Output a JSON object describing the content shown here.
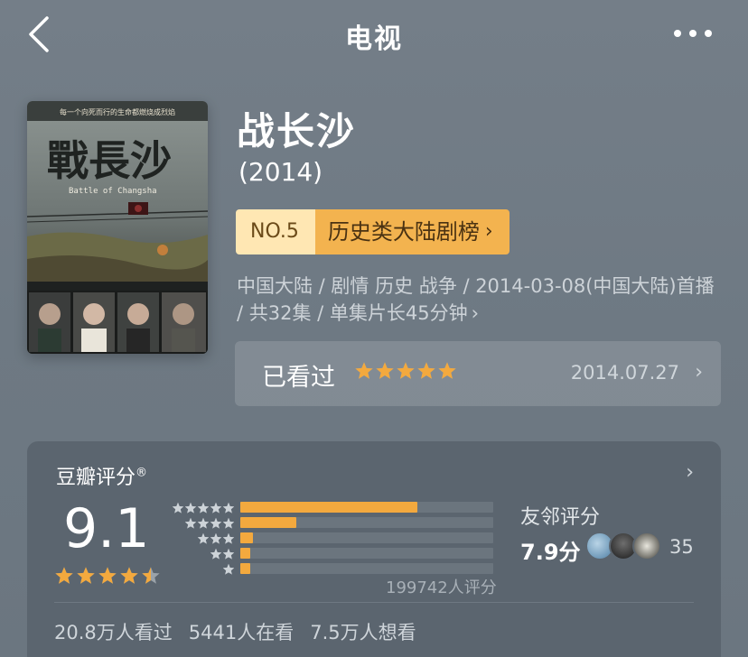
{
  "header": {
    "title": "电视"
  },
  "poster": {
    "tagline": "每一个向死而行的生命都燃烧成烈焰",
    "calligraphy": "戰長沙",
    "english": "Battle of Changsha"
  },
  "movie": {
    "title": "战长沙",
    "year": "(2014)"
  },
  "rank": {
    "number": "NO.5",
    "name": "历史类大陆剧榜",
    "chevron": "›"
  },
  "meta": {
    "line": "中国大陆 / 剧情 历史 战争 / 2014-03-08(中国大陆)首播 / 共32集 / 单集片长45分钟"
  },
  "watched": {
    "label": "已看过",
    "stars": 5,
    "date": "2014.07.27",
    "chevron": "›"
  },
  "rating": {
    "title": "豆瓣评分",
    "registered": "®",
    "score": "9.1",
    "stars": 4.5,
    "count": "199742人评分",
    "distribution": [
      {
        "stars": 5,
        "fraction": 0.7
      },
      {
        "stars": 4,
        "fraction": 0.22
      },
      {
        "stars": 3,
        "fraction": 0.05
      },
      {
        "stars": 2,
        "fraction": 0.02
      },
      {
        "stars": 1,
        "fraction": 0.01
      }
    ],
    "friend_label": "友邻评分",
    "friend_score": "7.9分",
    "friend_count": "35",
    "chevron": "›"
  },
  "stats": {
    "watched": "20.8万人看过",
    "watching": "5441人在看",
    "want": "7.5万人想看"
  },
  "colors": {
    "star": "#f3a93e",
    "rank_badge_left": "#ffe7b3",
    "rank_badge_right": "#f3b34f"
  }
}
